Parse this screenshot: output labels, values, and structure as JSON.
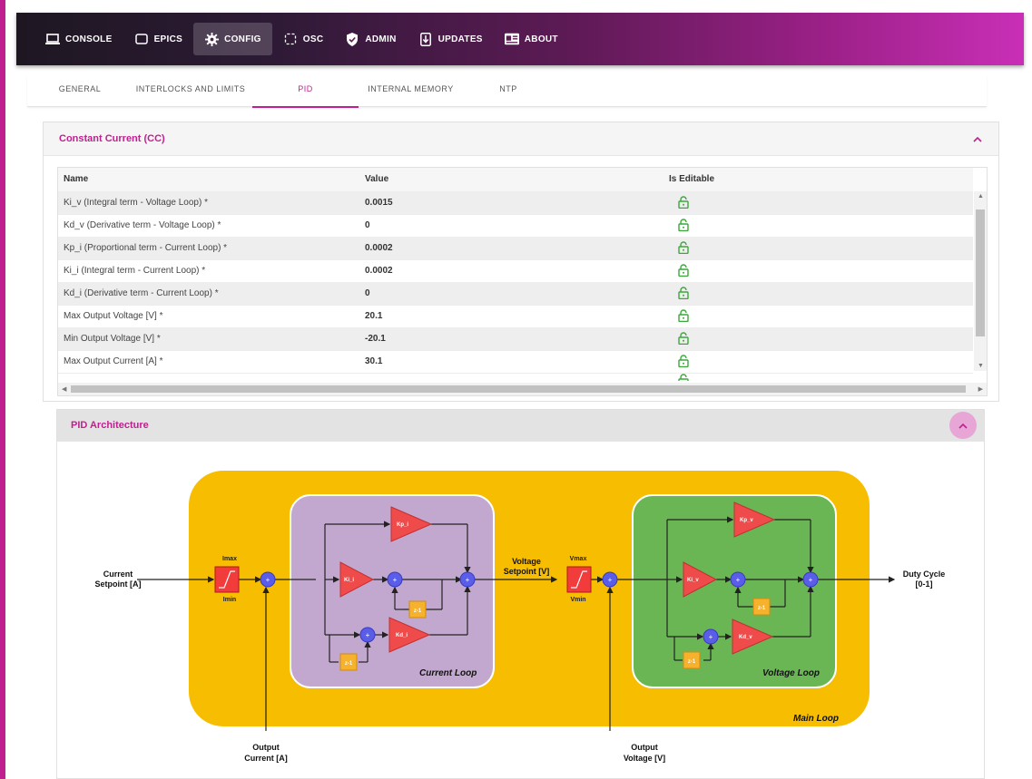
{
  "nav": {
    "items": [
      {
        "label": "CONSOLE",
        "icon": "laptop-icon",
        "active": false
      },
      {
        "label": "EPICS",
        "icon": "epics-icon",
        "active": false
      },
      {
        "label": "CONFIG",
        "icon": "gear-icon",
        "active": true
      },
      {
        "label": "OSC",
        "icon": "oscilloscope-icon",
        "active": false
      },
      {
        "label": "ADMIN",
        "icon": "shield-icon",
        "active": false
      },
      {
        "label": "UPDATES",
        "icon": "download-icon",
        "active": false
      },
      {
        "label": "ABOUT",
        "icon": "info-card-icon",
        "active": false
      }
    ]
  },
  "tabs": {
    "items": [
      "GENERAL",
      "INTERLOCKS AND LIMITS",
      "PID",
      "INTERNAL MEMORY",
      "NTP"
    ],
    "active": "PID"
  },
  "cc_panel": {
    "title": "Constant Current (CC)",
    "headers": [
      "Name",
      "Value",
      "Is Editable"
    ],
    "rows": [
      {
        "name": "Ki_v (Integral term - Voltage Loop) *",
        "value": "0.0015",
        "editable": true
      },
      {
        "name": "Kd_v (Derivative term - Voltage Loop) *",
        "value": "0",
        "editable": true
      },
      {
        "name": "Kp_i (Proportional term - Current Loop) *",
        "value": "0.0002",
        "editable": true
      },
      {
        "name": "Ki_i (Integral term - Current Loop) *",
        "value": "0.0002",
        "editable": true
      },
      {
        "name": "Kd_i (Derivative term - Current Loop) *",
        "value": "0",
        "editable": true
      },
      {
        "name": "Max Output Voltage [V] *",
        "value": "20.1",
        "editable": true
      },
      {
        "name": "Min Output Voltage [V] *",
        "value": "-20.1",
        "editable": true
      },
      {
        "name": "Max Output Current [A] *",
        "value": "30.1",
        "editable": true
      }
    ]
  },
  "pid_panel": {
    "title": "PID Architecture",
    "diagram": {
      "labels": {
        "current_setpoint": [
          "Current",
          "Setpoint [A]"
        ],
        "voltage_setpoint": [
          "Voltage",
          "Setpoint [V]"
        ],
        "duty_cycle": [
          "Duty Cycle",
          "[0-1]"
        ],
        "output_current": [
          "Output",
          "Current [A]"
        ],
        "output_voltage": [
          "Output",
          "Voltage [V]"
        ],
        "current_loop": "Current Loop",
        "voltage_loop": "Voltage Loop",
        "main_loop": "Main Loop",
        "kp_i": "Kp_i",
        "ki_i": "Ki_i",
        "kd_i": "Kd_i",
        "kp_v": "Kp_v",
        "ki_v": "Ki_v",
        "kd_v": "Kd_v",
        "imax": "Imax",
        "imin": "Imin",
        "vmax": "Vmax",
        "vmin": "Vmin",
        "delay": "z-1",
        "sum": "+"
      },
      "colors": {
        "main_loop": "#f7bd00",
        "current_loop": "#c2a8cf",
        "voltage_loop": "#6ab655",
        "gain": "#ef4b4b",
        "delay": "#f6b22c",
        "sum": "#5a5de8",
        "limiter": "#f23c3c"
      }
    }
  }
}
